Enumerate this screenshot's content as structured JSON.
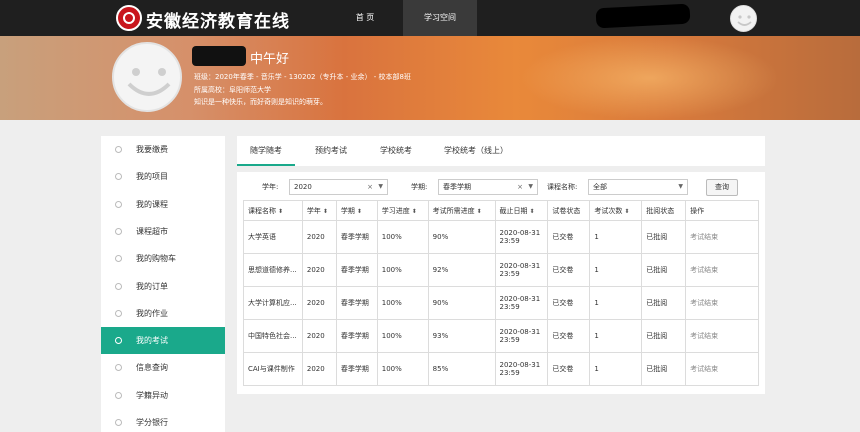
{
  "header": {
    "site_title": "安徽经济教育在线",
    "nav": [
      "首 页",
      "学习空间"
    ]
  },
  "banner": {
    "greeting": "中午好",
    "class_info": "班级：2020年春季 - 音乐学 - 130202（专升本 - 业余） - 校本部8班",
    "school": "所属高校：阜阳师范大学",
    "motto": "知识是一种快乐，而好奇则是知识的萌芽。"
  },
  "sidebar": {
    "items": [
      {
        "label": "我要缴费"
      },
      {
        "label": "我的项目"
      },
      {
        "label": "我的课程"
      },
      {
        "label": "课程超市"
      },
      {
        "label": "我的购物车"
      },
      {
        "label": "我的订单"
      },
      {
        "label": "我的作业"
      },
      {
        "label": "我的考试"
      },
      {
        "label": "信息查询"
      },
      {
        "label": "学籍异动"
      },
      {
        "label": "学分银行"
      }
    ],
    "active_index": 7
  },
  "tabs": [
    "随学随考",
    "预约考试",
    "学校统考",
    "学校统考（线上）"
  ],
  "filters": {
    "year_label": "学年:",
    "year_value": "2020",
    "term_label": "学期:",
    "term_value": "春季学期",
    "course_label": "课程名称:",
    "course_value": "全部",
    "query_button": "查询"
  },
  "table": {
    "headers": [
      "课程名称",
      "学年",
      "学期",
      "学习进度",
      "考试所需进度",
      "截止日期",
      "试卷状态",
      "考试次数",
      "批阅状态",
      "操作"
    ],
    "sortable": [
      true,
      true,
      true,
      true,
      true,
      true,
      false,
      true,
      false,
      false
    ],
    "rows": [
      [
        "大学英语",
        "2020",
        "春季学期",
        "100%",
        "90%",
        "2020-08-31 23:59",
        "已交卷",
        "1",
        "已批阅",
        "考试结束"
      ],
      [
        "思想道德修养...",
        "2020",
        "春季学期",
        "100%",
        "92%",
        "2020-08-31 23:59",
        "已交卷",
        "1",
        "已批阅",
        "考试结束"
      ],
      [
        "大学计算机应...",
        "2020",
        "春季学期",
        "100%",
        "90%",
        "2020-08-31 23:59",
        "已交卷",
        "1",
        "已批阅",
        "考试结束"
      ],
      [
        "中国特色社会...",
        "2020",
        "春季学期",
        "100%",
        "93%",
        "2020-08-31 23:59",
        "已交卷",
        "1",
        "已批阅",
        "考试结束"
      ],
      [
        "CAI与课件制作",
        "2020",
        "春季学期",
        "100%",
        "85%",
        "2020-08-31 23:59",
        "已交卷",
        "1",
        "已批阅",
        "考试结束"
      ]
    ]
  },
  "colors": {
    "accent": "#1aa98b",
    "topbar": "#1f1f1f",
    "brand_red": "#c8161d"
  }
}
